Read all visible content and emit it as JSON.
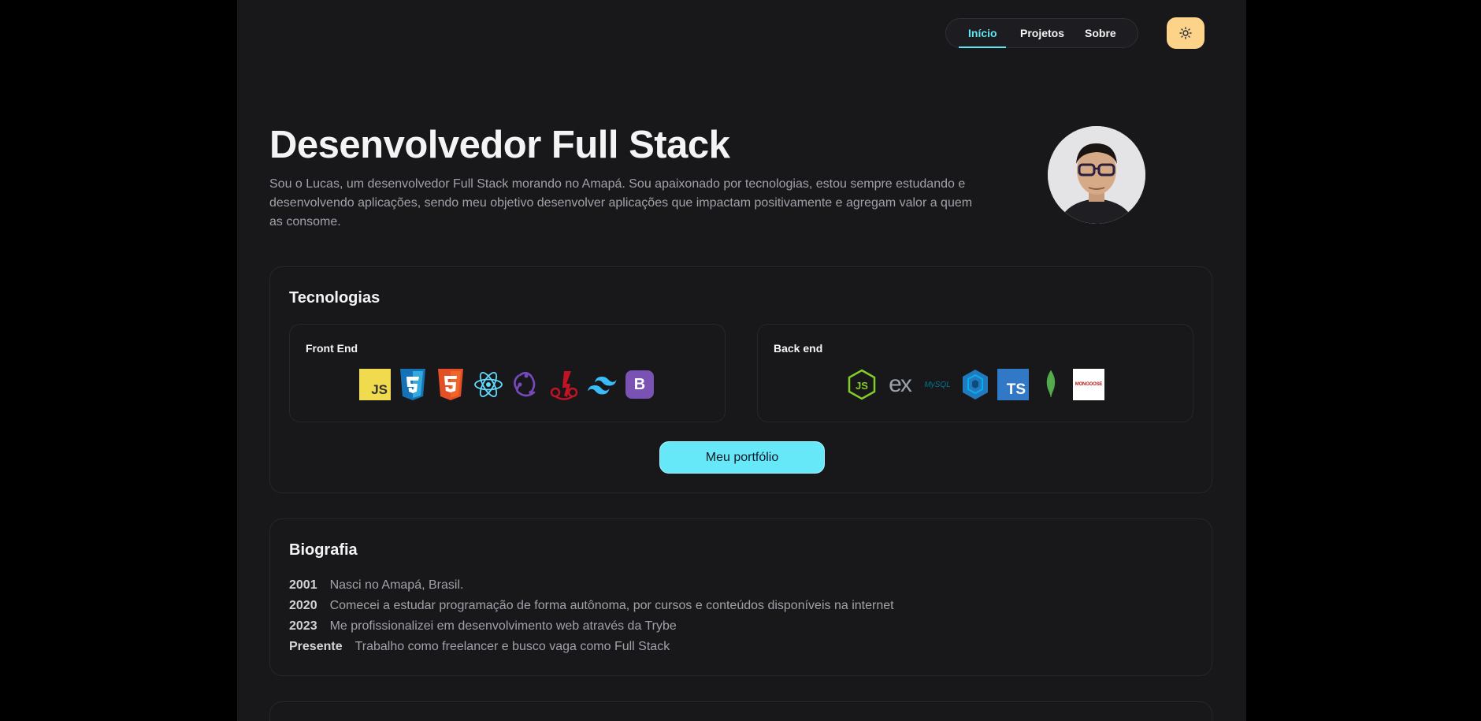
{
  "nav": {
    "items": [
      "Início",
      "Projetos",
      "Sobre"
    ],
    "active": "Início",
    "theme_icon": "sun-icon"
  },
  "hero": {
    "title": "Desenvolvedor Full Stack",
    "description": "Sou o Lucas, um desenvolvedor Full Stack morando no Amapá. Sou apaixonado por tecnologias, estou sempre estudando e desenvolvendo aplicações, sendo meu objetivo desenvolver aplicações que impactam positivamente e agregam valor a quem as consome."
  },
  "tech": {
    "title": "Tecnologias",
    "front_title": "Front End",
    "back_title": "Back end",
    "front_icons": [
      "javascript-icon",
      "css3-icon",
      "html5-icon",
      "react-icon",
      "redux-icon",
      "jest-icon",
      "tailwind-icon",
      "bootstrap-icon"
    ],
    "back_icons": [
      "nodejs-icon",
      "express-icon",
      "mysql-icon",
      "sequelize-icon",
      "typescript-icon",
      "mongodb-icon",
      "mongoose-icon"
    ],
    "js_text": "JS",
    "ts_text": "TS",
    "bootstrap_text": "B",
    "express_text": "ex",
    "mysql_text": "MySQL",
    "mongoose_text": "MONGOOSE",
    "cta": "Meu portfólio"
  },
  "bio": {
    "title": "Biografia",
    "entries": [
      {
        "year": "2001",
        "text": "Nasci no Amapá, Brasil."
      },
      {
        "year": "2020",
        "text": "Comecei a estudar programação de forma autônoma, por cursos e conteúdos disponíveis na internet"
      },
      {
        "year": "2023",
        "text": "Me profissionalizei em desenvolvimento web através da Trybe"
      },
      {
        "year": "Presente",
        "text": "Trabalho como freelancer e busco vaga como Full Stack"
      }
    ]
  },
  "colors": {
    "accent": "#5ee7f2",
    "cta": "#67e8f9",
    "theme_button": "#fdd38a",
    "background": "#18181b"
  }
}
